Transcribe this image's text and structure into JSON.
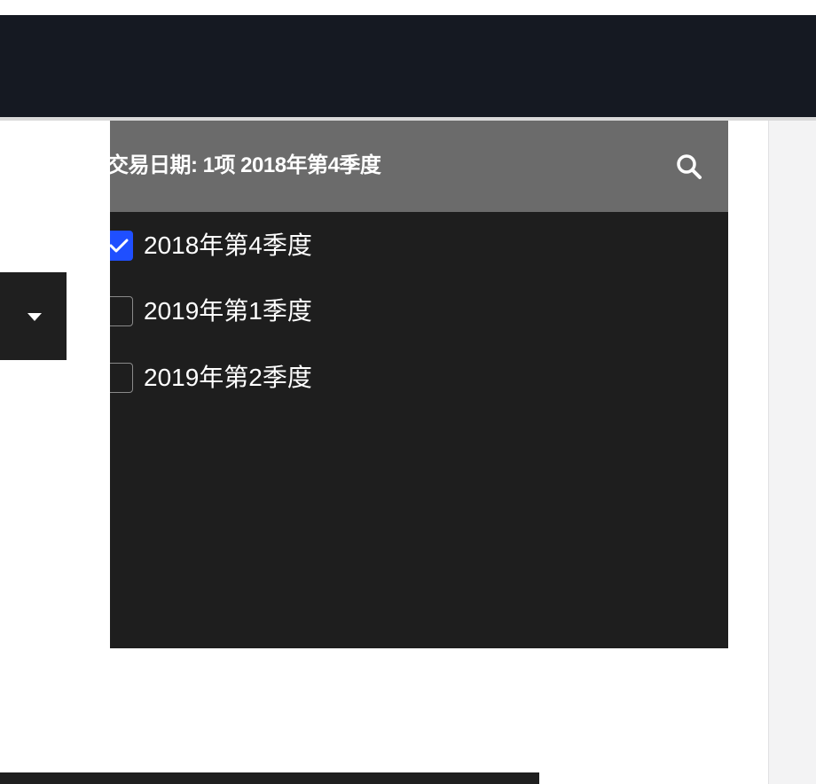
{
  "filter": {
    "title": "交易日期: 1项 2018年第4季度",
    "options": [
      {
        "label": "2018年第4季度",
        "checked": true
      },
      {
        "label": "2019年第1季度",
        "checked": false
      },
      {
        "label": "2019年第2季度",
        "checked": false
      }
    ]
  },
  "colors": {
    "top_bar": "#151922",
    "popup_header": "#6b6b6b",
    "popup_body": "#1e1e1e",
    "checkbox_checked": "#1f4fff"
  },
  "icons": {
    "search": "search-icon",
    "dropdown": "caret-down-icon",
    "check": "check-icon"
  }
}
